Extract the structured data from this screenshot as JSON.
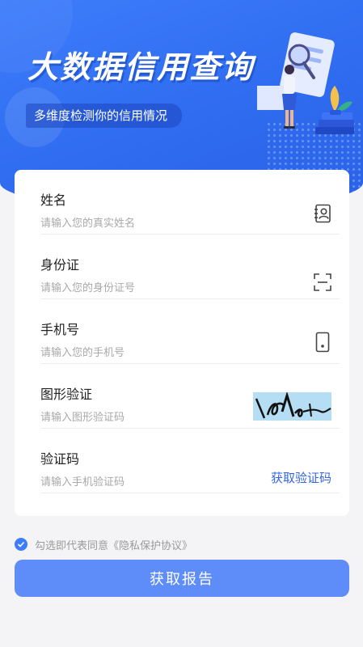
{
  "hero": {
    "title": "大数据信用查询",
    "subtitle": "多维度检测你的信用情况"
  },
  "form": {
    "fields": [
      {
        "label": "姓名",
        "placeholder": "请输入您的真实姓名",
        "icon": "contact-card-icon"
      },
      {
        "label": "身份证",
        "placeholder": "请输入您的身份证号",
        "icon": "scan-icon"
      },
      {
        "label": "手机号",
        "placeholder": "请输入您的手机号",
        "icon": "phone-icon"
      },
      {
        "label": "图形验证",
        "placeholder": "请输入图形验证码",
        "icon": "captcha-image"
      },
      {
        "label": "验证码",
        "placeholder": "请输入手机验证码",
        "action": "获取验证码"
      }
    ]
  },
  "agreement": {
    "text": "勾选即代表同意《隐私保护协议》",
    "checked": true
  },
  "submit": {
    "label": "获取报告"
  },
  "colors": {
    "primary": "#3d7dfb",
    "button": "#5e8cf8",
    "link": "#3366e0",
    "background": "#f4f4f6"
  }
}
